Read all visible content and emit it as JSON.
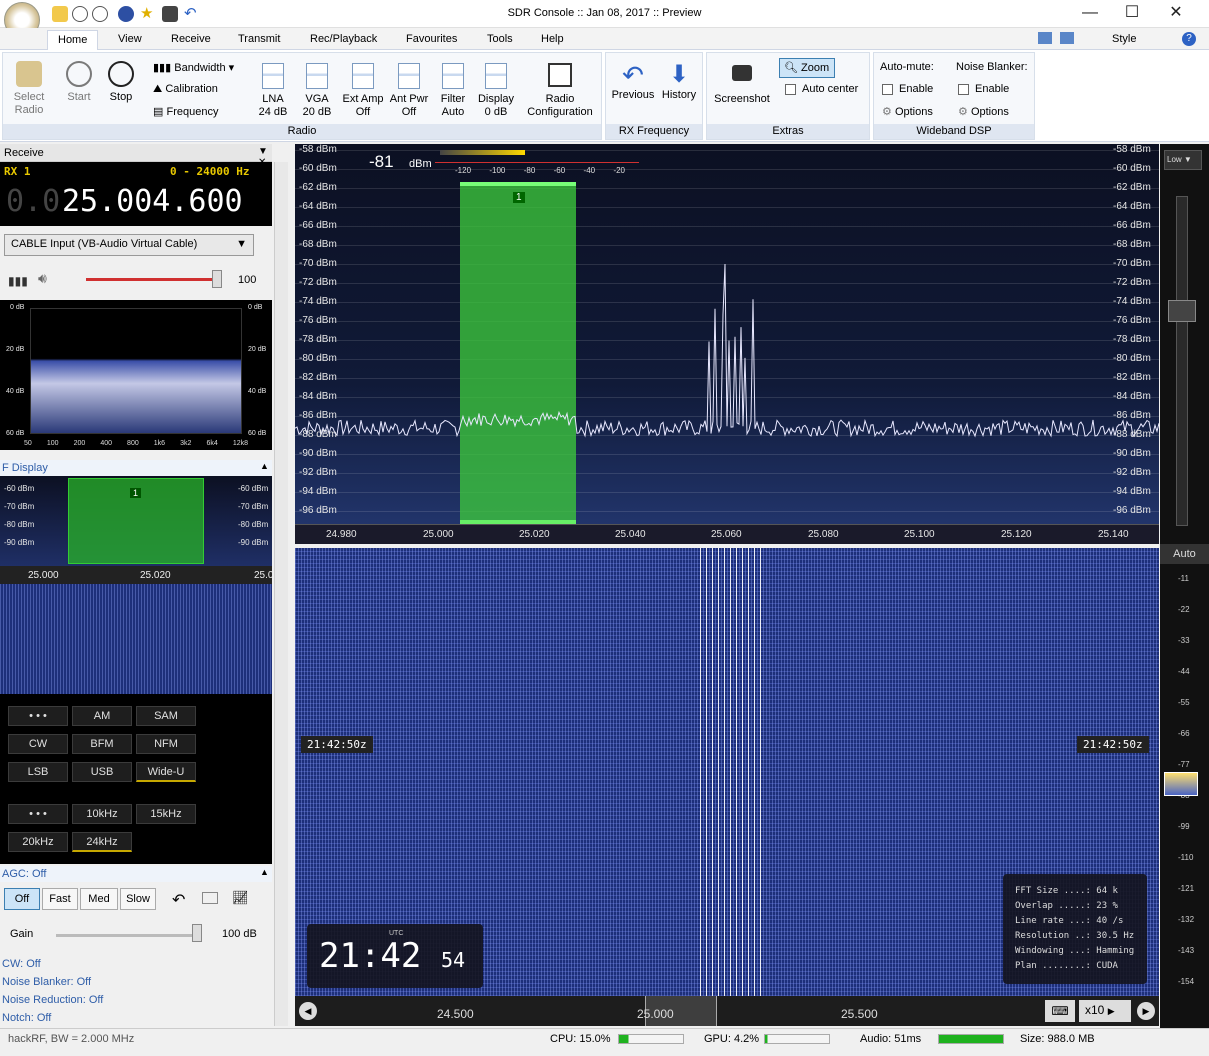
{
  "window": {
    "title": "SDR Console :: Jan 08, 2017 :: Preview",
    "minimize": "—",
    "maximize": "☐",
    "close": "✕"
  },
  "menu": [
    "Home",
    "View",
    "Receive",
    "Transmit",
    "Rec/Playback",
    "Favourites",
    "Tools",
    "Help"
  ],
  "style_label": "Style",
  "ribbon": {
    "select_radio": [
      "Select",
      "Radio"
    ],
    "start": "Start",
    "stop": "Stop",
    "bandwidth": "Bandwidth",
    "calibration": "Calibration",
    "frequency": "Frequency",
    "lna": [
      "LNA",
      "24 dB"
    ],
    "vga": [
      "VGA",
      "20 dB"
    ],
    "ext_amp": [
      "Ext Amp",
      "Off"
    ],
    "ant_pwr": [
      "Ant Pwr",
      "Off"
    ],
    "filter": [
      "Filter",
      "Auto"
    ],
    "display": [
      "Display",
      "0 dB"
    ],
    "radio_config": [
      "Radio",
      "Configuration"
    ],
    "radio_group": "Radio",
    "previous": "Previous",
    "history": "History",
    "rx_group": "RX Frequency",
    "screenshot": "Screenshot",
    "zoom": "Zoom",
    "auto_center": "Auto center",
    "extras_group": "Extras",
    "auto_mute": "Auto-mute:",
    "noise_blanker": "Noise Blanker:",
    "enable": "Enable",
    "options": "Options",
    "wdsp_group": "Wideband DSP"
  },
  "receive": {
    "panel_title": "Receive",
    "rx": "RX 1",
    "range": "0 - 24000 Hz",
    "freq_dim": "0.0",
    "freq": "25.004.600",
    "input": "CABLE Input (VB-Audio Virtual Cable)",
    "volume": "100",
    "audio_db": [
      "0 dB",
      "20 dB",
      "40 dB",
      "60 dB"
    ],
    "audio_freqs": [
      "50",
      "100",
      "200",
      "400",
      "800",
      "1k6",
      "3k2",
      "6k4",
      "12k8"
    ],
    "if_display": "F Display",
    "if_db_left": [
      "-60 dBm",
      "-70 dBm",
      "-80 dBm",
      "-90 dBm"
    ],
    "if_db_right": [
      "-60 dBm",
      "-70 dBm",
      "-80 dBm",
      "-90 dBm"
    ],
    "if_ticks": [
      "25.000",
      "25.020",
      "25.0"
    ],
    "if_marker": "1",
    "modes": [
      "• • •",
      "AM",
      "SAM",
      "CW",
      "BFM",
      "NFM",
      "LSB",
      "USB",
      "Wide-U"
    ],
    "bandwidths": [
      "• • •",
      "10kHz",
      "15kHz",
      "20kHz",
      "24kHz"
    ],
    "agc": "AGC: Off",
    "agc_buttons": [
      "Off",
      "Fast",
      "Med",
      "Slow"
    ],
    "gain_label": "Gain",
    "gain_value": "100 dB",
    "cw": "CW: Off",
    "nb": "Noise Blanker: Off",
    "nr": "Noise Reduction: Off",
    "notch": "Notch: Off"
  },
  "spectrum": {
    "db_labels": [
      "-58 dBm",
      "-60 dBm",
      "-62 dBm",
      "-64 dBm",
      "-66 dBm",
      "-68 dBm",
      "-70 dBm",
      "-72 dBm",
      "-74 dBm",
      "-76 dBm",
      "-78 dBm",
      "-80 dBm",
      "-82 dBm",
      "-84 dBm",
      "-86 dBm",
      "-88 dBm",
      "-90 dBm",
      "-92 dBm",
      "-94 dBm",
      "-96 dBm"
    ],
    "signal": "-81",
    "signal_unit": "dBm",
    "smeter_ticks": [
      "-120",
      "-100",
      "-80",
      "-60",
      "-40",
      "-20"
    ],
    "marker": "1",
    "freq_ticks": [
      "24.980",
      "25.000",
      "25.020",
      "25.040",
      "25.060",
      "25.080",
      "25.100",
      "25.120",
      "25.140"
    ],
    "low_label": "Low ▼"
  },
  "waterfall": {
    "time_tag": "21:42:50z",
    "clock_utc": "UTC",
    "clock_hm": "21:42",
    "clock_s": "54",
    "info": [
      "FFT Size ....: 64 k",
      "Overlap .....: 23 %",
      "Line rate ...: 40 /s",
      "Resolution ..: 30.5 Hz",
      "Windowing ...: Hamming",
      "Plan ........: CUDA"
    ],
    "auto": "Auto",
    "scale": [
      "-11",
      "-22",
      "-33",
      "-44",
      "-55",
      "-66",
      "-77",
      "-88",
      "-99",
      "-110",
      "-121",
      "-132",
      "-143",
      "-154"
    ],
    "overview_ticks": [
      "24.500",
      "25.000",
      "25.500"
    ],
    "zoom": "x10"
  },
  "status": {
    "left": "hackRF, BW = 2.000 MHz",
    "cpu": "CPU: 15.0%",
    "gpu": "GPU: 4.2%",
    "audio": "Audio: 51ms",
    "size": "Size: 988.0 MB"
  }
}
